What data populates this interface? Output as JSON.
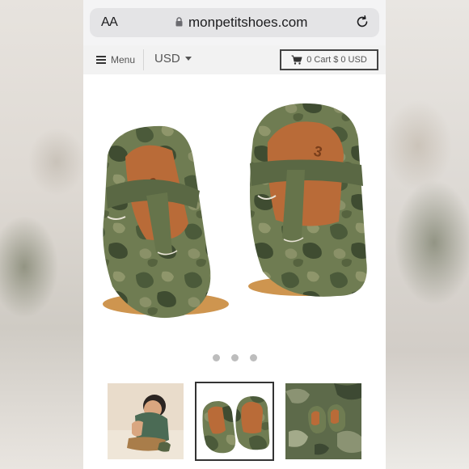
{
  "browser": {
    "text_size_label": "AA",
    "url": "monpetitshoes.com",
    "icons": [
      "lock-icon",
      "reload-icon"
    ]
  },
  "header": {
    "menu_label": "Menu",
    "currency_label": "USD",
    "cart_label": "0 Cart $ 0 USD",
    "icons": [
      "hamburger-icon",
      "caret-down-icon",
      "cart-icon"
    ]
  },
  "product": {
    "image_description_icon": "camo-t-strap-baby-shoes",
    "insole_size": "3",
    "carousel_dots": 3,
    "thumbnails": [
      {
        "name": "baby-wearing-shoes"
      },
      {
        "name": "shoes-pair-selected"
      },
      {
        "name": "shoes-on-camo-fabric"
      }
    ]
  },
  "colors": {
    "camo_dark": "#4b5a3a",
    "camo_mid": "#6f7c52",
    "camo_light": "#8a9168",
    "leather": "#b96b38",
    "sole": "#c98a3c"
  }
}
